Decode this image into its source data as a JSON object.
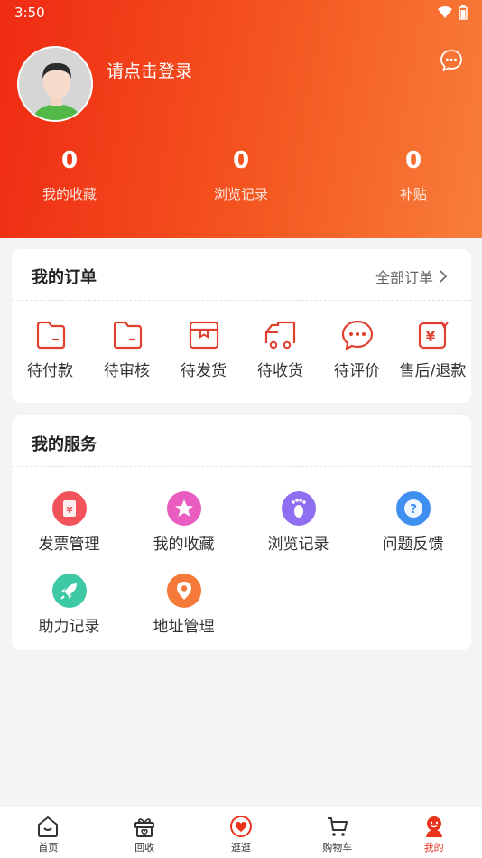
{
  "status_bar": {
    "time": "3:50"
  },
  "profile": {
    "login_text": "请点击登录"
  },
  "stats": [
    {
      "value": "0",
      "label": "我的收藏"
    },
    {
      "value": "0",
      "label": "浏览记录"
    },
    {
      "value": "0",
      "label": "补贴"
    }
  ],
  "orders": {
    "title": "我的订单",
    "all_link": "全部订单",
    "items": [
      {
        "label": "待付款",
        "icon": "wallet-icon"
      },
      {
        "label": "待审核",
        "icon": "review-icon"
      },
      {
        "label": "待发货",
        "icon": "package-icon"
      },
      {
        "label": "待收货",
        "icon": "truck-icon"
      },
      {
        "label": "待评价",
        "icon": "comment-icon"
      },
      {
        "label": "售后/退款",
        "icon": "refund-icon"
      }
    ]
  },
  "services": {
    "title": "我的服务",
    "items": [
      {
        "label": "发票管理",
        "icon": "invoice-icon",
        "color": "#f2535a"
      },
      {
        "label": "我的收藏",
        "icon": "star-icon",
        "color": "#e95cc0"
      },
      {
        "label": "浏览记录",
        "icon": "footprint-icon",
        "color": "#8f6ef2"
      },
      {
        "label": "问题反馈",
        "icon": "question-icon",
        "color": "#3f8ff0"
      },
      {
        "label": "助力记录",
        "icon": "rocket-icon",
        "color": "#3cc9a3"
      },
      {
        "label": "地址管理",
        "icon": "location-icon",
        "color": "#f57a3a"
      }
    ]
  },
  "tabbar": {
    "items": [
      {
        "label": "首页",
        "icon": "home-icon"
      },
      {
        "label": "回收",
        "icon": "recycle-gift-icon"
      },
      {
        "label": "逛逛",
        "icon": "heart-icon"
      },
      {
        "label": "购物车",
        "icon": "cart-icon"
      },
      {
        "label": "我的",
        "icon": "profile-icon"
      }
    ],
    "active_index": 4
  },
  "colors": {
    "accent": "#e8341d",
    "header_start": "#ef2a14",
    "header_end": "#f87e3a"
  }
}
